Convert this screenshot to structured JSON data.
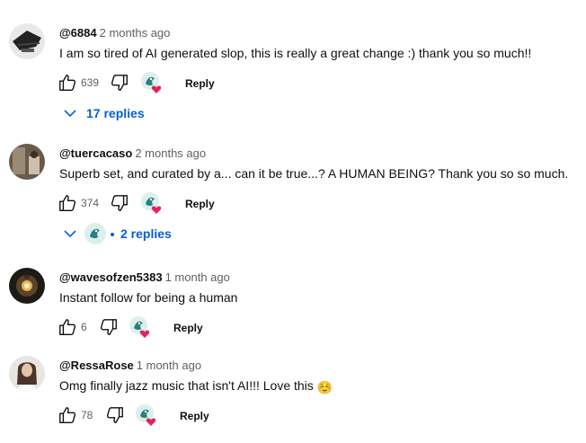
{
  "comments": [
    {
      "handle": "@6884",
      "time": "2 months ago",
      "text": "I am so tired of AI generated slop, this is really a great change :) thank you so much!!",
      "likes": "639",
      "reply_label": "Reply",
      "replies_label": "17 replies"
    },
    {
      "handle": "@tuercacaso",
      "time": "2 months ago",
      "text": "Superb set, and curated by a... can it be true...? A HUMAN BEING? Thank you so so much.",
      "likes": "374",
      "reply_label": "Reply",
      "replies_label": "2 replies"
    },
    {
      "handle": "@wavesofzen5383",
      "time": "1 month ago",
      "text": "Instant follow for being a human",
      "likes": "6",
      "reply_label": "Reply"
    },
    {
      "handle": "@RessaRose",
      "time": "1 month ago",
      "text": "Omg finally jazz music that isn't AI!!! Love this",
      "emoji": "☺️",
      "likes": "78",
      "reply_label": "Reply"
    }
  ],
  "colors": {
    "link": "#065fd4",
    "muted": "#606060",
    "heart": "#e0245e",
    "creator_badge": "#2a7f7f"
  },
  "icons": [
    "like-icon",
    "dislike-icon",
    "creator-heart-icon",
    "chevron-down-icon"
  ]
}
